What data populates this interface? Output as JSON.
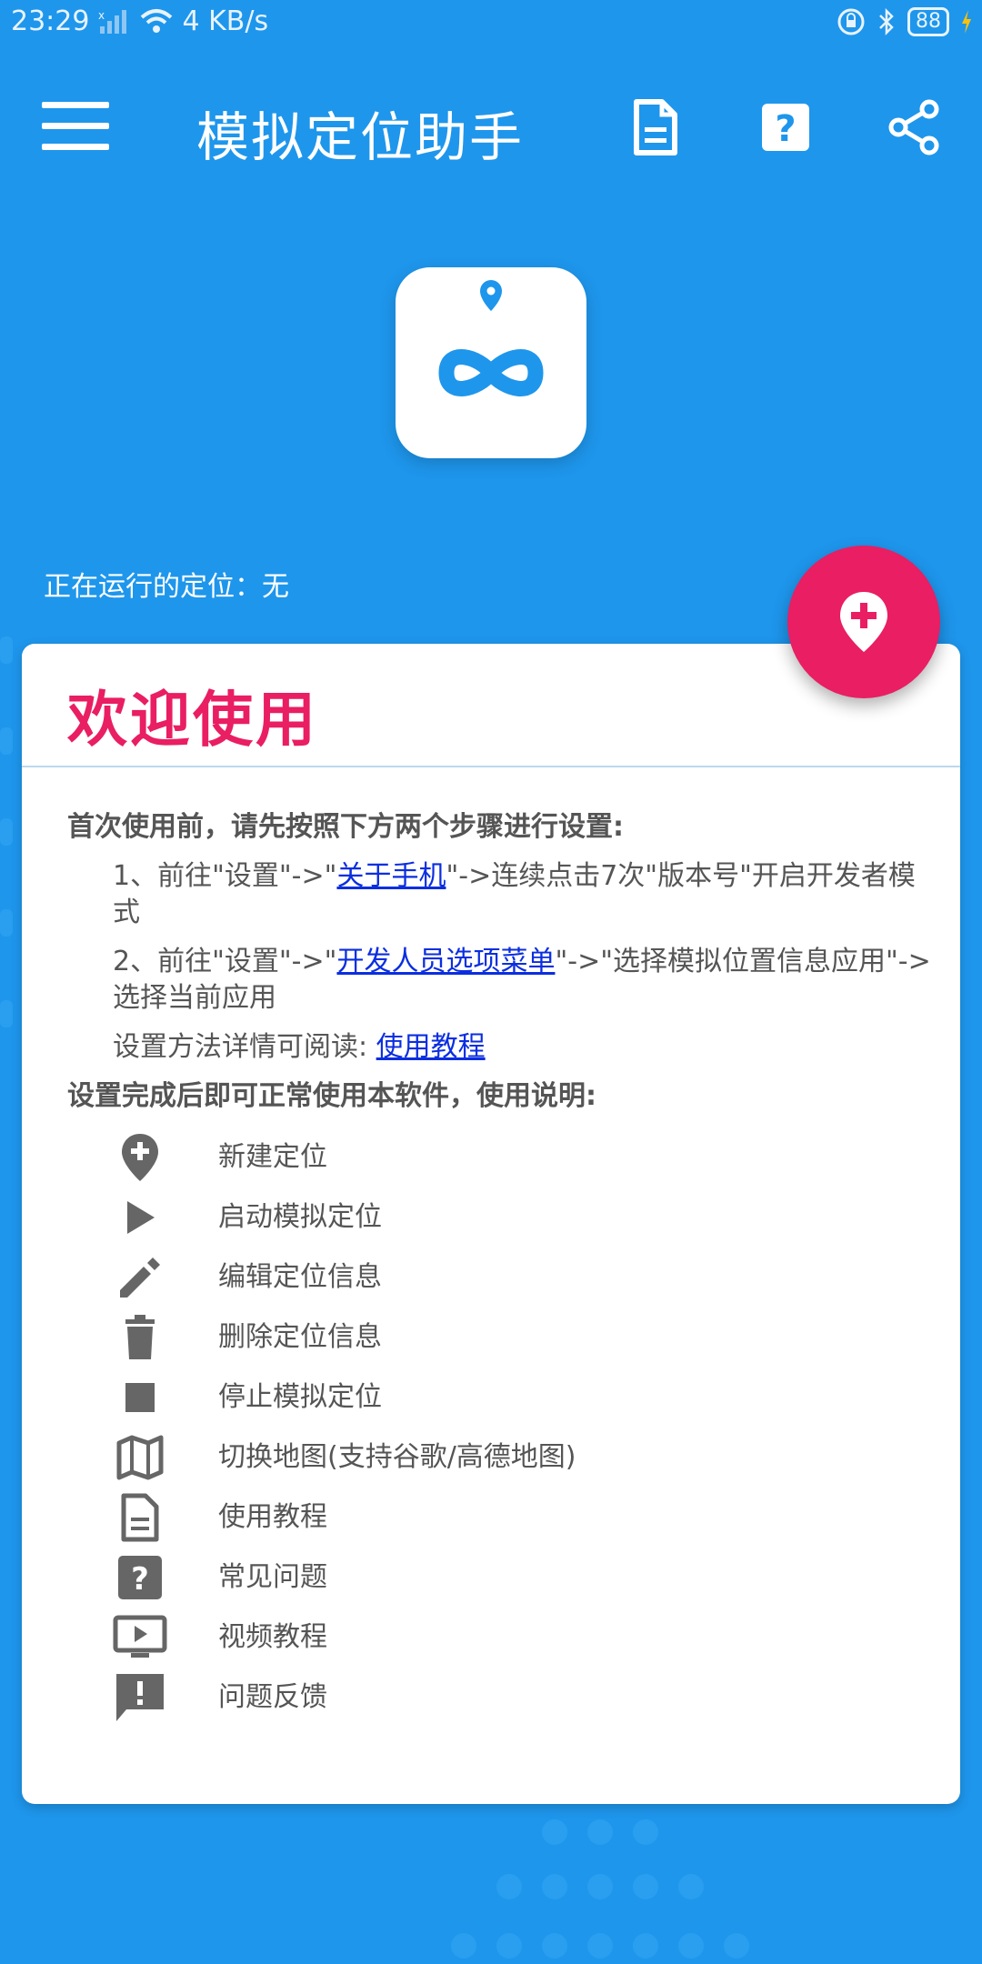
{
  "status_bar": {
    "time": "23:29",
    "network_speed": "4 KB/s",
    "battery": "88"
  },
  "app_bar": {
    "title": "模拟定位助手",
    "menu_icon": "hamburger-menu-icon",
    "actions": [
      "document-icon",
      "help-icon",
      "share-icon"
    ]
  },
  "running": {
    "label": "正在运行的定位：",
    "value": "无"
  },
  "card": {
    "title": "欢迎使用",
    "intro": "首次使用前，请先按照下方两个步骤进行设置:",
    "step1_a": "1、前往\"设置\"->\"",
    "step1_link": "关于手机",
    "step1_b": "\"->连续点击7次\"版本号\"开启开发者模式",
    "step2_a": "2、前往\"设置\"->\"",
    "step2_link": "开发人员选项菜单",
    "step2_b": "\"->\"选择模拟位置信息应用\"->选择当前应用",
    "detail_label": "设置方法详情可阅读: ",
    "detail_link": "使用教程",
    "usage_title": "设置完成后即可正常使用本软件，使用说明:",
    "legend": [
      {
        "icon": "add-location-icon",
        "label": "新建定位"
      },
      {
        "icon": "play-icon",
        "label": "启动模拟定位"
      },
      {
        "icon": "edit-icon",
        "label": "编辑定位信息"
      },
      {
        "icon": "delete-icon",
        "label": "删除定位信息"
      },
      {
        "icon": "stop-icon",
        "label": "停止模拟定位"
      },
      {
        "icon": "map-icon",
        "label": "切换地图(支持谷歌/高德地图)"
      },
      {
        "icon": "document-icon",
        "label": "使用教程"
      },
      {
        "icon": "help-icon",
        "label": "常见问题"
      },
      {
        "icon": "video-icon",
        "label": "视频教程"
      },
      {
        "icon": "feedback-icon",
        "label": "问题反馈"
      }
    ]
  },
  "colors": {
    "background": "#1E96EC",
    "accent": "#E91E63",
    "link": "#0B2EE0"
  }
}
